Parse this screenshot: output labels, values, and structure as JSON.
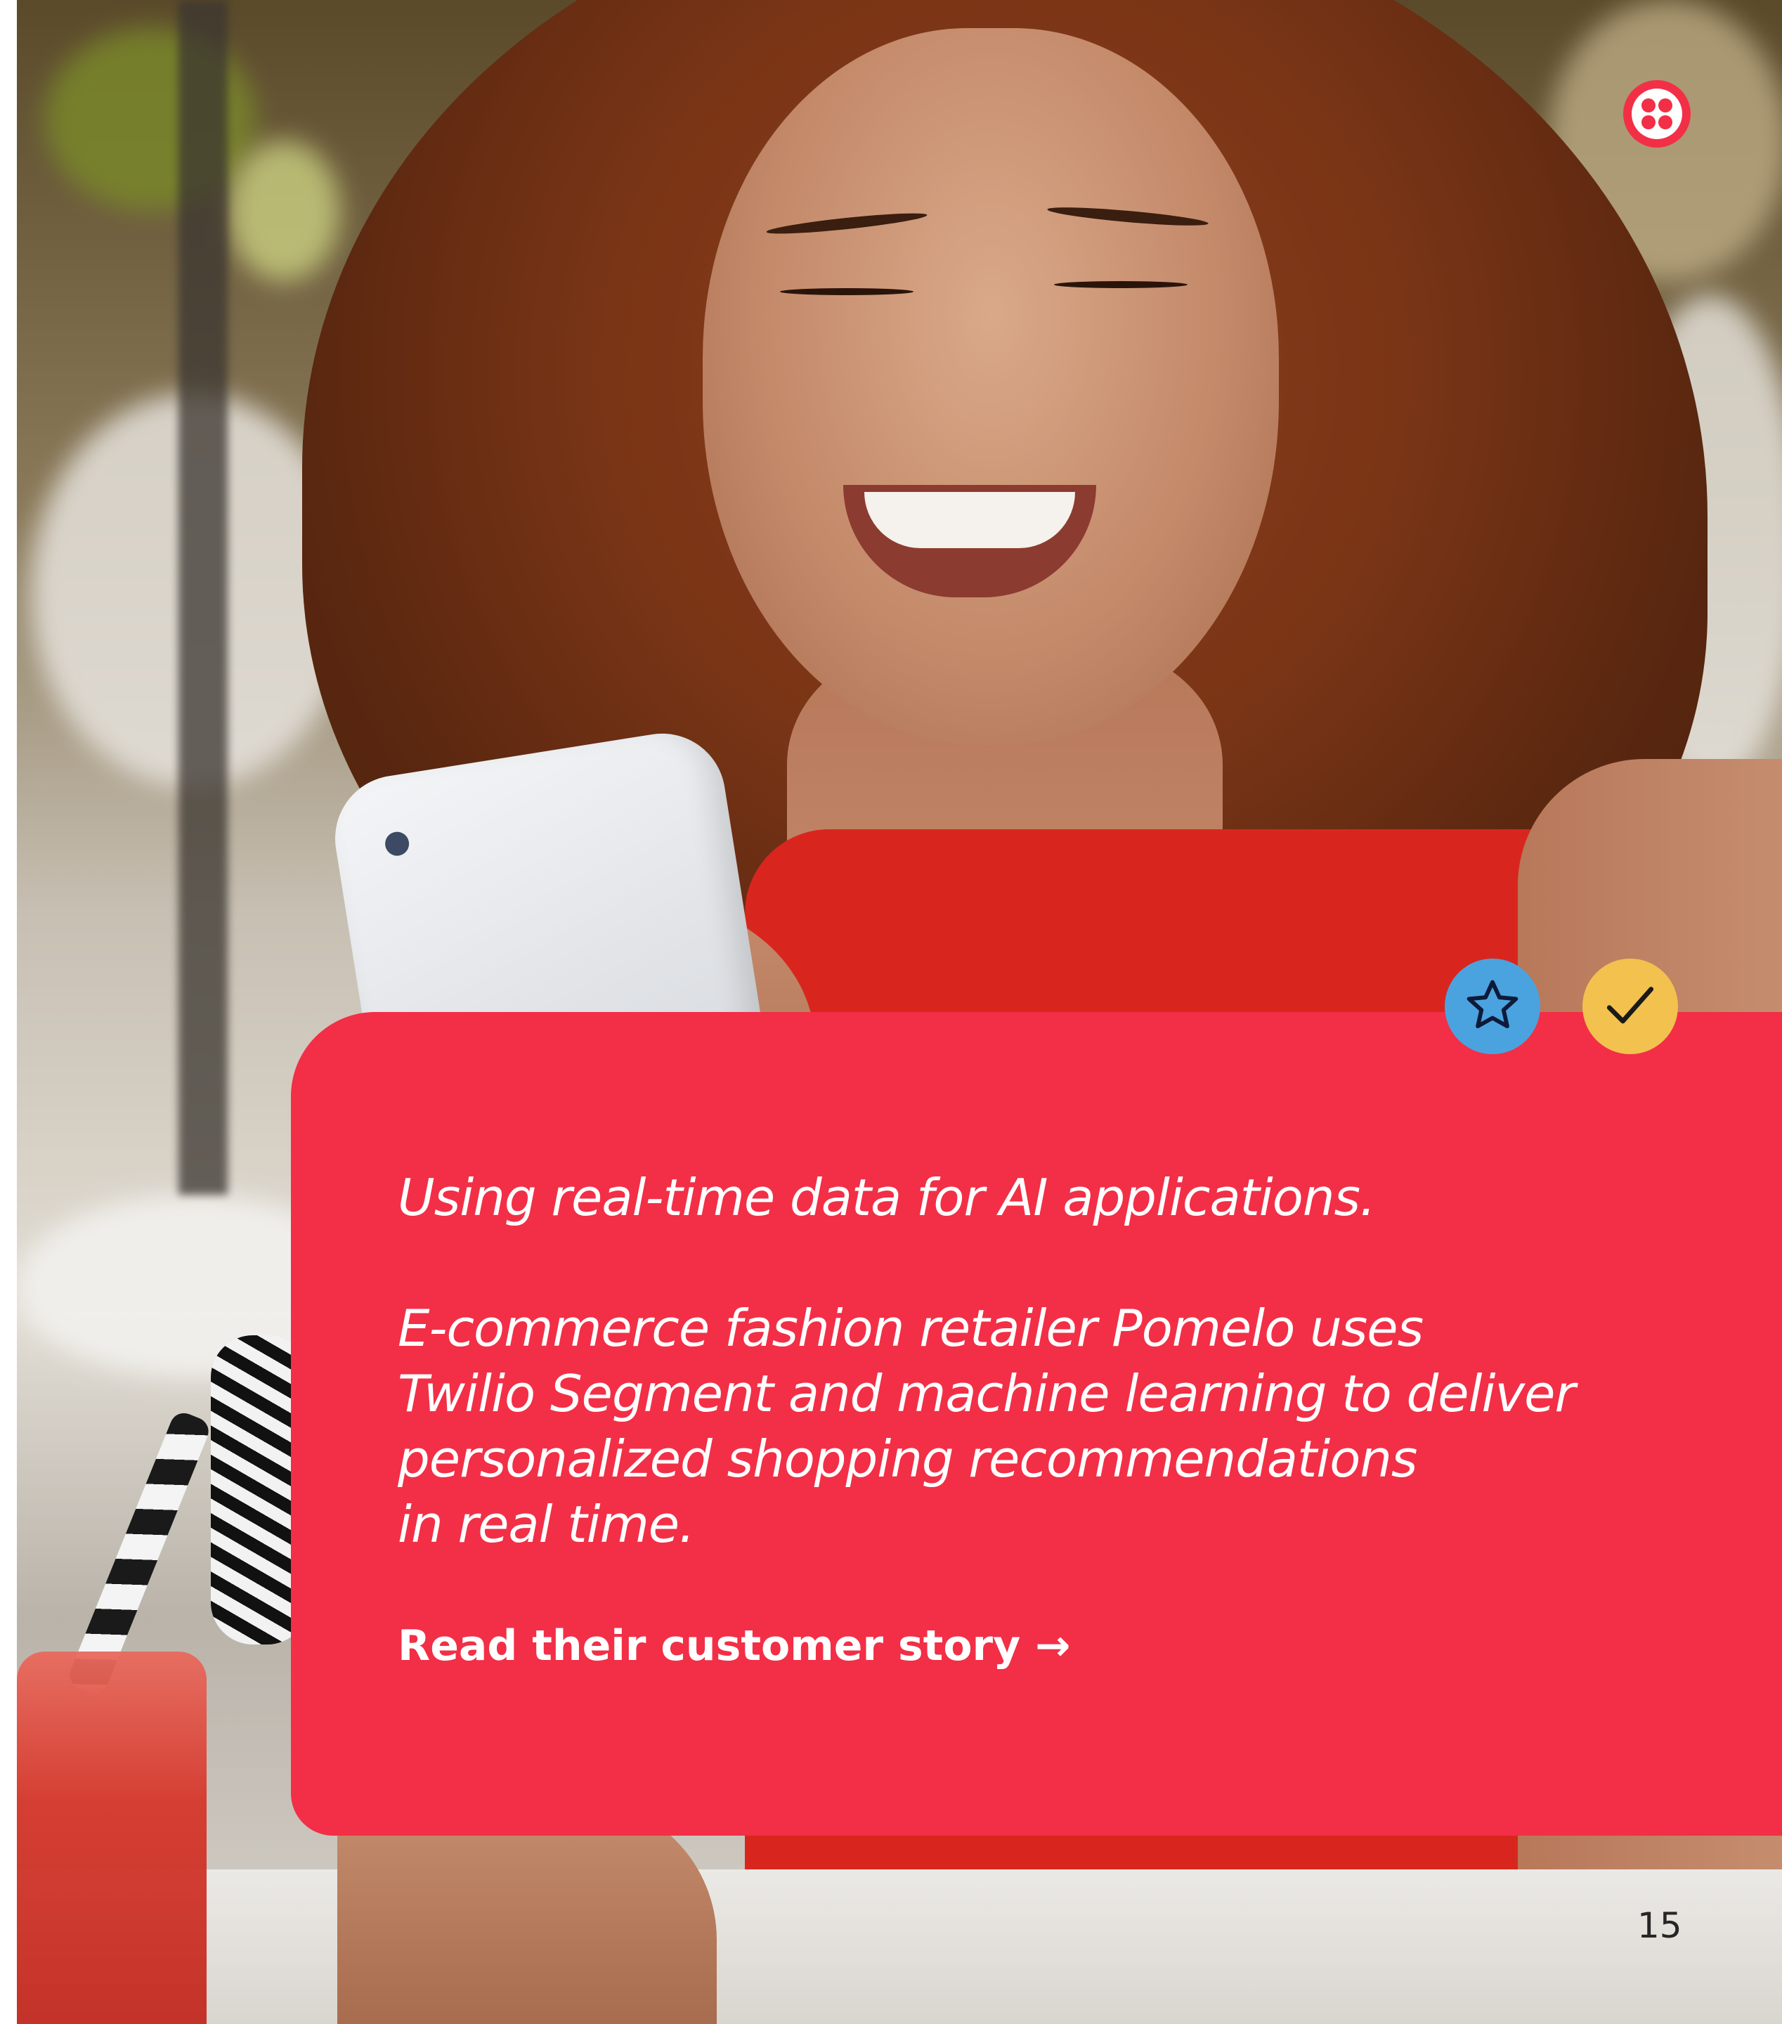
{
  "card": {
    "headline": "Using real-time data for AI applications.",
    "body_lines": [
      "E-commerce fashion retailer Pomelo uses",
      "Twilio Segment and machine learning to deliver",
      "personalized shopping recommendations",
      "in real time."
    ],
    "cta_label": "Read their customer story →",
    "background_color": "#f22f46"
  },
  "page_number": "15",
  "icons": {
    "logo": "twilio-logo-icon",
    "badge_star": "star-icon",
    "badge_check": "checkmark-icon"
  },
  "colors": {
    "brand_red": "#f22f46",
    "badge_blue": "#4aa3df",
    "badge_yellow": "#f2c14e"
  }
}
